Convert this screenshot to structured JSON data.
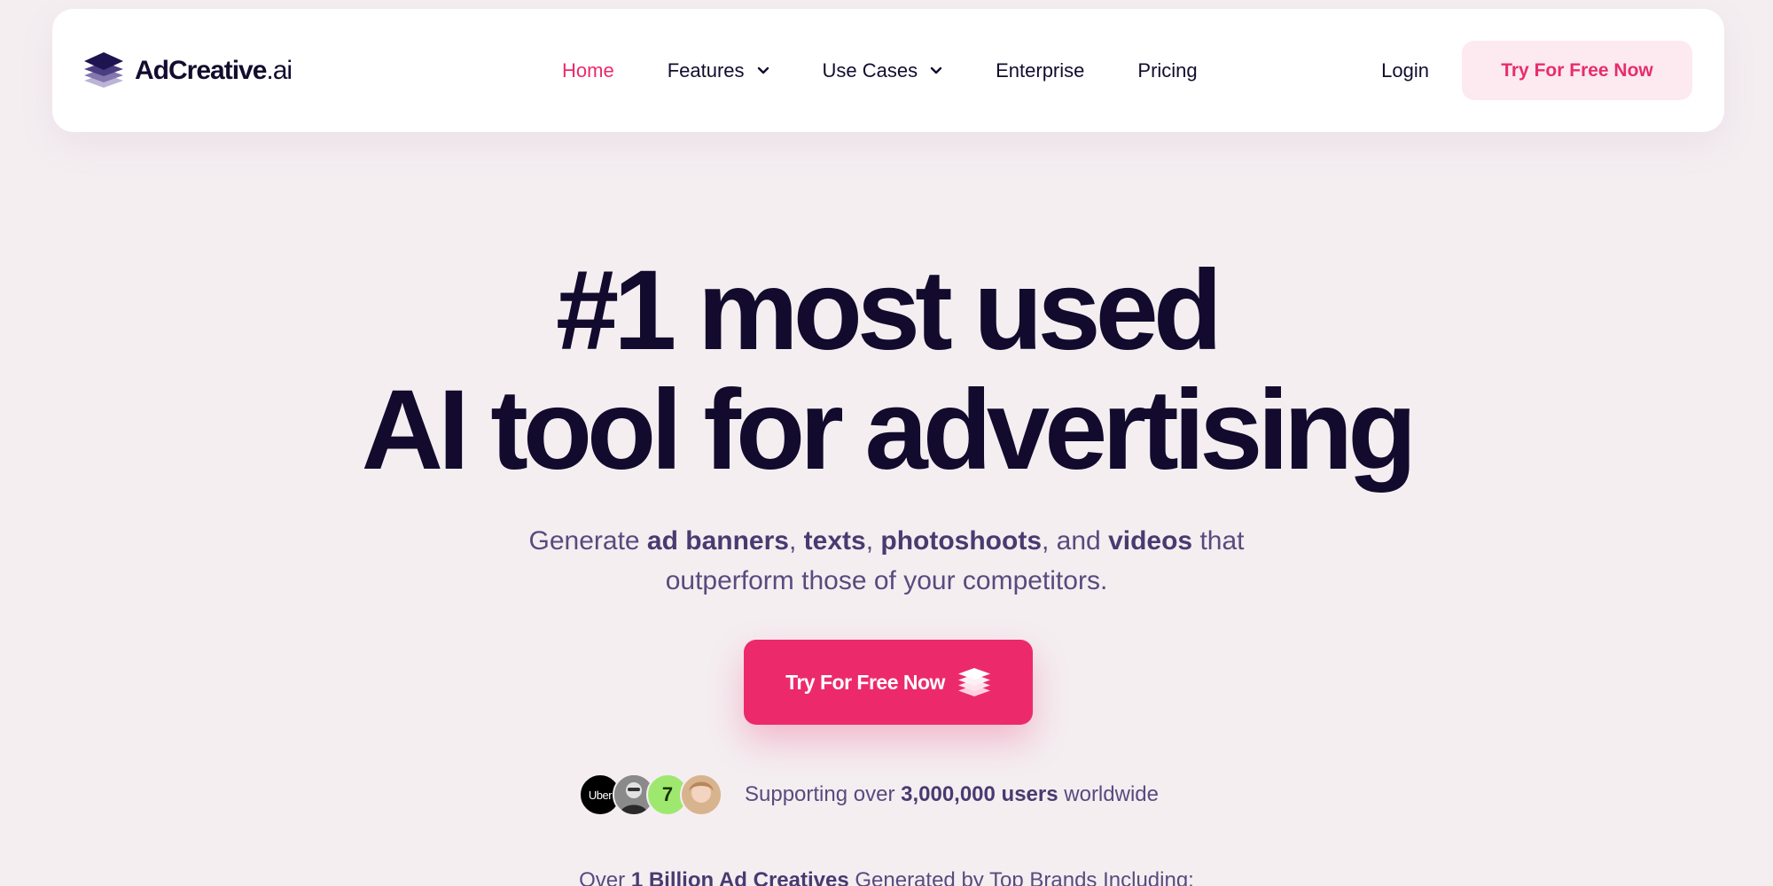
{
  "brand": {
    "logo_name": "AdCreative",
    "logo_tld": ".ai",
    "accent_color": "#ea2b6a",
    "dark_color": "#130c2e"
  },
  "nav": {
    "items": [
      {
        "label": "Home",
        "active": true
      },
      {
        "label": "Features",
        "dropdown": true
      },
      {
        "label": "Use Cases",
        "dropdown": true
      },
      {
        "label": "Enterprise"
      },
      {
        "label": "Pricing"
      }
    ],
    "login": "Login",
    "cta": "Try For Free Now"
  },
  "hero": {
    "title_line1": "#1 most used",
    "title_line2": "AI tool for advertising",
    "subtitle": {
      "part1": "Generate ",
      "b1": "ad banners",
      "part2": ", ",
      "b2": "texts",
      "part3": ", ",
      "b3": "photoshoots",
      "part4": ", and ",
      "b4": "videos",
      "part5": " that",
      "line2": "outperform those of your competitors."
    },
    "cta": "Try For Free Now"
  },
  "social_proof": {
    "avatars": [
      {
        "name": "uber-logo",
        "text": "Uber"
      },
      {
        "name": "user-man",
        "text": ""
      },
      {
        "name": "wise-logo",
        "text": "7"
      },
      {
        "name": "user-woman",
        "text": ""
      }
    ],
    "prefix": "Supporting over ",
    "count": "3,000,000 users",
    "suffix": " worldwide"
  },
  "brands": {
    "prefix": "Over ",
    "bold": "1 Billion Ad Creatives",
    "suffix": " Generated by Top Brands Including:"
  }
}
